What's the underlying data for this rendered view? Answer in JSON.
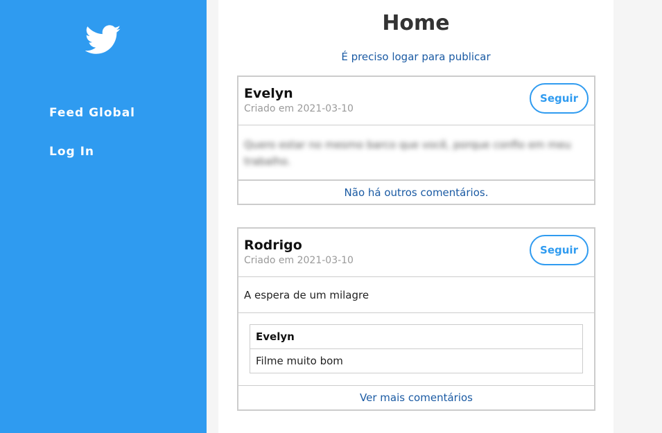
{
  "sidebar": {
    "logo_icon": "twitter-bird-icon",
    "items": [
      {
        "label": "Feed Global"
      },
      {
        "label": "Log In"
      }
    ]
  },
  "main": {
    "title": "Home",
    "login_notice": "É preciso logar para publicar"
  },
  "posts": [
    {
      "author": "Evelyn",
      "created": "Criado em 2021-03-10",
      "follow_label": "Seguir",
      "text": "Quero estar no mesmo barco que você, porque confio em meu trabalho.",
      "comments": [],
      "footer": "Não há outros comentários."
    },
    {
      "author": "Rodrigo",
      "created": "Criado em 2021-03-10",
      "follow_label": "Seguir",
      "text": "A espera de um milagre",
      "comments": [
        {
          "author": "Evelyn",
          "text": "Filme muito bom"
        }
      ],
      "footer": "Ver mais comentários"
    }
  ],
  "colors": {
    "sidebar_bg": "#2f9bf0",
    "accent": "#2f9bf0",
    "link": "#1a5aa3"
  }
}
